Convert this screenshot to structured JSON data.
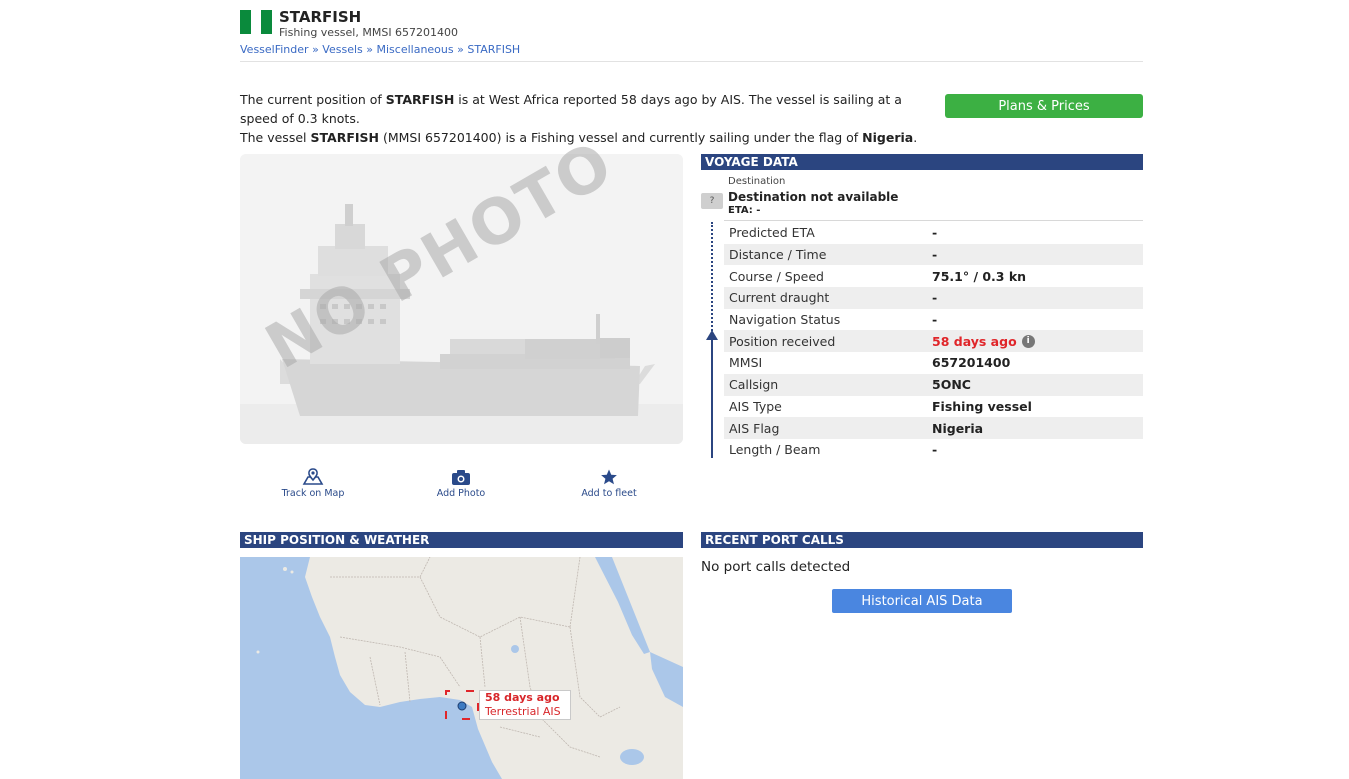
{
  "header": {
    "vessel_name": "STARFISH",
    "subtitle": "Fishing vessel, MMSI 657201400",
    "flag_colors": [
      "#0a8a3c",
      "#ffffff",
      "#0a8a3c"
    ],
    "breadcrumb": [
      "VesselFinder",
      "Vessels",
      "Miscellaneous",
      "STARFISH"
    ],
    "breadcrumb_sep": "»"
  },
  "intro": {
    "l1_a": "The current position of ",
    "l1_name": "STARFISH",
    "l1_b": " is at West Africa reported 58 days ago by AIS. The vessel is sailing at a speed of 0.3 knots.",
    "l2_a": "The vessel ",
    "l2_name": "STARFISH",
    "l2_b": " (MMSI 657201400) is a Fishing vessel and currently sailing under the flag of ",
    "l2_flag": "Nigeria",
    "l2_c": "."
  },
  "plans_button": "Plans & Prices",
  "photo": {
    "overlay_text": "NO PHOTO"
  },
  "actions": [
    {
      "label": "Track on Map",
      "icon": "map-pin-icon"
    },
    {
      "label": "Add Photo",
      "icon": "camera-icon"
    },
    {
      "label": "Add to fleet",
      "icon": "star-icon"
    }
  ],
  "voyage": {
    "title": "VOYAGE DATA",
    "destination_label": "Destination",
    "destination_value": "Destination not available",
    "eta": "ETA: -",
    "unknown_port_mark": "?",
    "rows": [
      {
        "key": "Predicted ETA",
        "value": "-"
      },
      {
        "key": "Distance / Time",
        "value": "-"
      },
      {
        "key": "Course / Speed",
        "value": "75.1° / 0.3 kn"
      },
      {
        "key": "Current draught",
        "value": "-"
      },
      {
        "key": "Navigation Status",
        "value": "-"
      },
      {
        "key": "Position received",
        "value": "58 days ago"
      },
      {
        "key": "MMSI",
        "value": "657201400"
      },
      {
        "key": "Callsign",
        "value": "5ONC"
      },
      {
        "key": "AIS Type",
        "value": "Fishing vessel"
      },
      {
        "key": "AIS Flag",
        "value": "Nigeria"
      },
      {
        "key": "Length / Beam",
        "value": "-"
      }
    ],
    "info_mark": "i"
  },
  "position": {
    "title": "SHIP POSITION & WEATHER",
    "label_time": "58 days ago",
    "label_source": "Terrestrial AIS"
  },
  "port_calls": {
    "title": "RECENT PORT CALLS",
    "empty_text": "No port calls detected",
    "button": "Historical AIS Data"
  },
  "colors": {
    "section_bar": "#2b4580",
    "plans_green": "#3cb043",
    "hist_blue": "#4a86e0",
    "alert_red": "#e0262a"
  }
}
